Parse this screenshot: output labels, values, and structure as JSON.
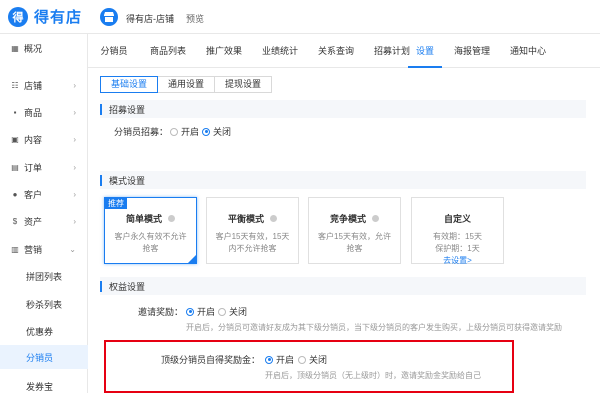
{
  "brand": {
    "logo_mark": "得",
    "name": "得有店"
  },
  "header": {
    "shop_name": "得有店-店铺",
    "preview": "预览"
  },
  "sidebar": {
    "items": [
      {
        "icon": "▦",
        "label": "概况",
        "arrow": ""
      },
      {
        "icon": "☷",
        "label": "店铺",
        "arrow": "›"
      },
      {
        "icon": "▪",
        "label": "商品",
        "arrow": "›"
      },
      {
        "icon": "▣",
        "label": "内容",
        "arrow": "›"
      },
      {
        "icon": "▤",
        "label": "订单",
        "arrow": "›"
      },
      {
        "icon": "●",
        "label": "客户",
        "arrow": "›"
      },
      {
        "icon": "$",
        "label": "资产",
        "arrow": "›"
      },
      {
        "icon": "▥",
        "label": "营销",
        "arrow": "⌄"
      }
    ],
    "sub_items": [
      "拼团列表",
      "秒杀列表",
      "优惠券",
      "分销员",
      "发券宝"
    ]
  },
  "tabs": [
    "分销员",
    "商品列表",
    "推广效果",
    "业绩统计",
    "关系查询",
    "招募计划",
    "设置",
    "海报管理",
    "通知中心"
  ],
  "subtabs": [
    "基础设置",
    "通用设置",
    "提现设置"
  ],
  "recruit": {
    "section": "招募设置",
    "label": "分销员招募：",
    "options": [
      "开启",
      "关闭"
    ],
    "selected": "关闭"
  },
  "mode": {
    "section": "模式设置",
    "cards": [
      {
        "tag": "推荐",
        "title": "简单模式",
        "desc": "客户永久有效不允许抢客"
      },
      {
        "tag": "",
        "title": "平衡模式",
        "desc": "客户15天有效，15天内不允许抢客"
      },
      {
        "tag": "",
        "title": "竞争模式",
        "desc": "客户15天有效，允许抢客"
      },
      {
        "tag": "",
        "title": "自定义",
        "desc1": "有效期：15天",
        "desc2": "保护期：1天",
        "link": "去设置>"
      }
    ]
  },
  "rights": {
    "section": "权益设置",
    "invite_label": "邀请奖励：",
    "invite_options": [
      "开启",
      "关闭"
    ],
    "invite_selected": "开启",
    "invite_hint": "开启后，分销员可邀请好友成为其下级分销员，当下级分销员的客户发生购买，上级分销员可获得邀请奖励",
    "top_label": "顶级分销员自得奖励金：",
    "top_options": [
      "开启",
      "关闭"
    ],
    "top_selected": "开启",
    "top_hint": "开启后，顶级分销员（无上级时）时，邀请奖励金奖励给自己"
  },
  "colors": {
    "accent": "#1a7df0",
    "highlight": "#e60012"
  }
}
